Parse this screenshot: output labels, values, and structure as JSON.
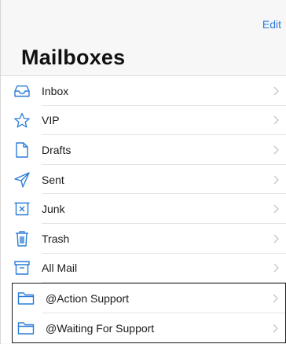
{
  "header": {
    "edit_label": "Edit",
    "title": "Mailboxes"
  },
  "mailboxes": [
    {
      "label": "Inbox",
      "icon": "inbox-tray-icon"
    },
    {
      "label": "VIP",
      "icon": "star-icon"
    },
    {
      "label": "Drafts",
      "icon": "document-icon"
    },
    {
      "label": "Sent",
      "icon": "paper-plane-icon"
    },
    {
      "label": "Junk",
      "icon": "junk-bin-icon"
    },
    {
      "label": "Trash",
      "icon": "trash-can-icon"
    },
    {
      "label": "All Mail",
      "icon": "archive-box-icon"
    }
  ],
  "custom_mailboxes": [
    {
      "label": "@Action Support",
      "icon": "folder-icon"
    },
    {
      "label": "@Waiting For Support",
      "icon": "folder-icon"
    }
  ],
  "colors": {
    "accent": "#2a7cd8",
    "chevron": "#c7c7cc"
  }
}
